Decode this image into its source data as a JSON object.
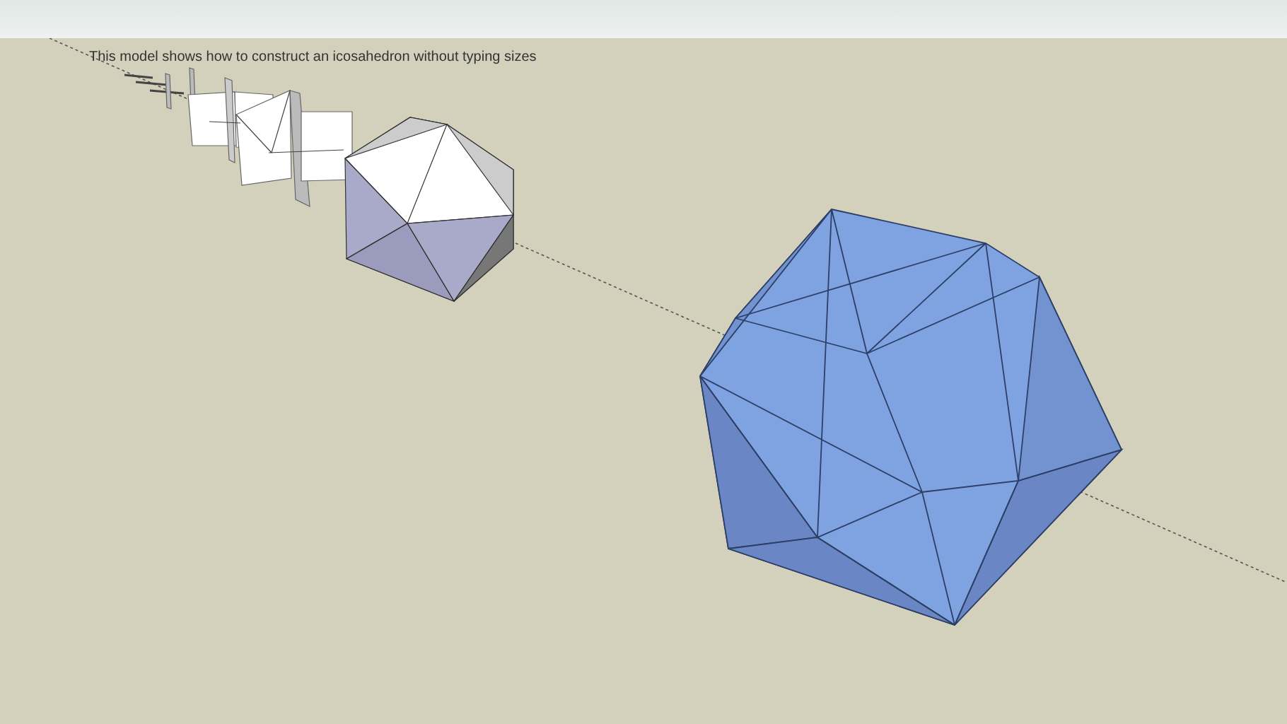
{
  "viewport": {
    "note": "This model shows how to construct an icosahedron without typing sizes"
  }
}
